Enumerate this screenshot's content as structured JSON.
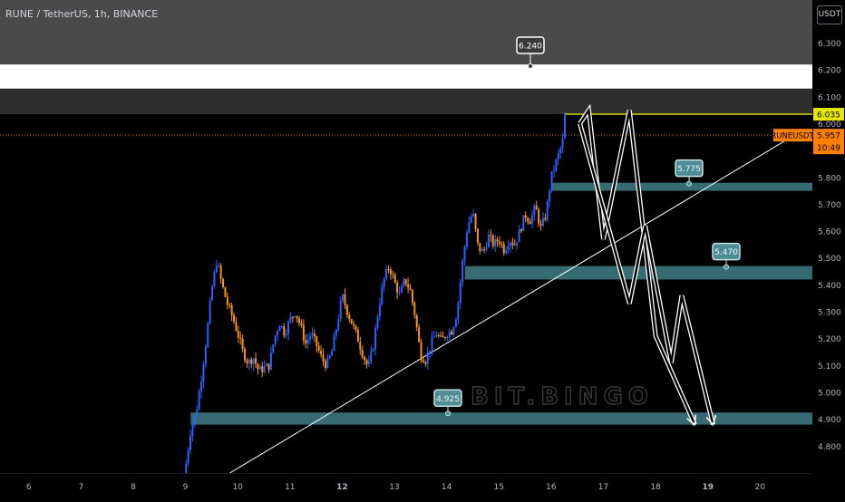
{
  "header": {
    "title": "RUNE / TetherUS, 1h, BINANCE",
    "currency": "USDT"
  },
  "watermark": "BIT.BINGO",
  "price_badge": {
    "symbol": "RUNEUSDT",
    "price": "5.957",
    "countdown": "10:49"
  },
  "level_labels": {
    "top_target": "6.240",
    "resistance": "6.035"
  },
  "colors": {
    "background": "#000000",
    "up_candle": "#2962ff",
    "down_candle": "#f7931a",
    "zone": "#3f7e86",
    "resistance_line": "#d4d400",
    "price_line": "#ff8000",
    "band_gray": "#4a4a4a",
    "band_white": "#ffffff"
  },
  "chart_data": {
    "type": "candlestick",
    "title": "RUNE / TetherUS, 1h, BINANCE",
    "symbol": "RUNEUSDT",
    "last_price": 5.957,
    "x_ticks": [
      "6",
      "7",
      "8",
      "9",
      "10",
      "11",
      "12",
      "13",
      "14",
      "15",
      "16",
      "17",
      "18",
      "19",
      "20"
    ],
    "y_ticks": [
      "4.800",
      "4.900",
      "5.000",
      "5.100",
      "5.200",
      "5.300",
      "5.400",
      "5.500",
      "5.600",
      "5.700",
      "5.800",
      "5.900",
      "6.000",
      "6.100",
      "6.200",
      "6.300"
    ],
    "ylim": [
      4.7,
      6.46
    ],
    "xlim": [
      5.45,
      21.0
    ],
    "grid": false,
    "series": [
      {
        "type": "price-path",
        "points": [
          [
            8.97,
            4.7
          ],
          [
            9.0,
            4.72
          ],
          [
            9.1,
            4.86
          ],
          [
            9.2,
            4.92
          ],
          [
            9.3,
            5.05
          ],
          [
            9.4,
            5.2
          ],
          [
            9.5,
            5.38
          ],
          [
            9.6,
            5.49
          ],
          [
            9.7,
            5.4
          ],
          [
            9.8,
            5.33
          ],
          [
            9.9,
            5.28
          ],
          [
            10.0,
            5.22
          ],
          [
            10.1,
            5.15
          ],
          [
            10.2,
            5.11
          ],
          [
            10.3,
            5.13
          ],
          [
            10.4,
            5.08
          ],
          [
            10.6,
            5.1
          ],
          [
            10.7,
            5.2
          ],
          [
            10.8,
            5.26
          ],
          [
            10.9,
            5.22
          ],
          [
            11.0,
            5.27
          ],
          [
            11.1,
            5.3
          ],
          [
            11.2,
            5.25
          ],
          [
            11.3,
            5.18
          ],
          [
            11.4,
            5.22
          ],
          [
            11.5,
            5.18
          ],
          [
            11.6,
            5.13
          ],
          [
            11.7,
            5.1
          ],
          [
            11.8,
            5.15
          ],
          [
            11.9,
            5.25
          ],
          [
            12.0,
            5.36
          ],
          [
            12.1,
            5.3
          ],
          [
            12.2,
            5.25
          ],
          [
            12.3,
            5.2
          ],
          [
            12.4,
            5.14
          ],
          [
            12.5,
            5.09
          ],
          [
            12.6,
            5.18
          ],
          [
            12.7,
            5.32
          ],
          [
            12.8,
            5.42
          ],
          [
            12.9,
            5.47
          ],
          [
            13.0,
            5.41
          ],
          [
            13.1,
            5.36
          ],
          [
            13.2,
            5.42
          ],
          [
            13.3,
            5.38
          ],
          [
            13.4,
            5.28
          ],
          [
            13.5,
            5.14
          ],
          [
            13.6,
            5.12
          ],
          [
            13.7,
            5.18
          ],
          [
            13.8,
            5.22
          ],
          [
            13.9,
            5.19
          ],
          [
            14.0,
            5.22
          ],
          [
            14.1,
            5.23
          ],
          [
            14.2,
            5.3
          ],
          [
            14.3,
            5.48
          ],
          [
            14.4,
            5.62
          ],
          [
            14.5,
            5.67
          ],
          [
            14.6,
            5.54
          ],
          [
            14.7,
            5.52
          ],
          [
            14.8,
            5.58
          ],
          [
            14.9,
            5.55
          ],
          [
            15.0,
            5.57
          ],
          [
            15.1,
            5.53
          ],
          [
            15.2,
            5.57
          ],
          [
            15.3,
            5.55
          ],
          [
            15.4,
            5.6
          ],
          [
            15.5,
            5.66
          ],
          [
            15.6,
            5.64
          ],
          [
            15.7,
            5.69
          ],
          [
            15.8,
            5.61
          ],
          [
            15.9,
            5.66
          ],
          [
            16.0,
            5.8
          ],
          [
            16.1,
            5.86
          ],
          [
            16.2,
            5.92
          ],
          [
            16.25,
            5.96
          ],
          [
            16.27,
            6.07
          ],
          [
            16.3,
            5.957
          ]
        ]
      }
    ],
    "annotations": {
      "levels": [
        {
          "label": "6.240",
          "value": 6.24
        },
        {
          "label": "6.035",
          "value": 6.035
        },
        {
          "label": "5.957",
          "value": 5.957
        }
      ],
      "zones": [
        {
          "label": "5.775",
          "value": 5.775,
          "range": [
            5.75,
            5.78
          ],
          "x_start": 16.0
        },
        {
          "label": "5.470",
          "value": 5.47,
          "range": [
            5.42,
            5.47
          ],
          "x_start": 14.35
        },
        {
          "label": "4.925",
          "value": 4.925,
          "range": [
            4.88,
            4.925
          ],
          "x_start": 9.1
        }
      ],
      "bands": [
        {
          "name": "upper-gray",
          "range": [
            6.2,
            6.46
          ],
          "color": "#4a4a4a"
        },
        {
          "name": "white",
          "range": [
            6.13,
            6.22
          ],
          "color": "#ffffff"
        },
        {
          "name": "lower-gray",
          "range": [
            6.035,
            6.13
          ],
          "color": "#2e2e2e"
        }
      ],
      "trendline": [
        [
          9.85,
          4.7
        ],
        [
          20.7,
          5.962
        ]
      ],
      "projected_paths": [
        [
          [
            16.55,
            6.0
          ],
          [
            16.72,
            6.05
          ],
          [
            17.0,
            5.57
          ],
          [
            17.5,
            6.05
          ],
          [
            18.0,
            5.21
          ],
          [
            18.75,
            4.88
          ]
        ],
        [
          [
            16.55,
            6.0
          ],
          [
            17.5,
            5.33
          ],
          [
            17.8,
            5.62
          ],
          [
            18.3,
            5.11
          ],
          [
            18.5,
            5.36
          ],
          [
            19.1,
            4.88
          ]
        ]
      ]
    }
  }
}
